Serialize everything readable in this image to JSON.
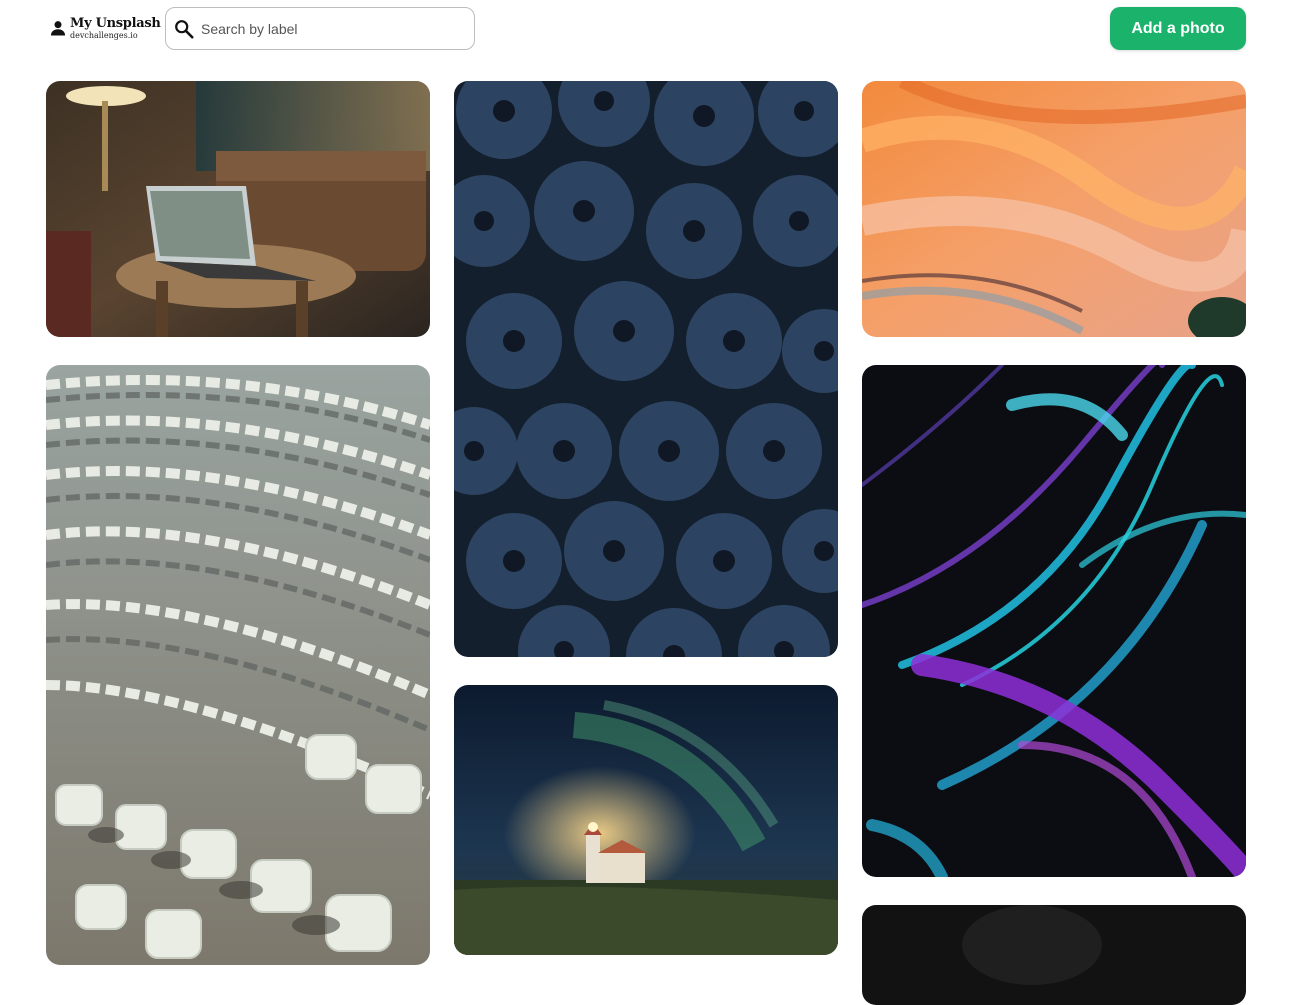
{
  "header": {
    "brand_title": "My Unsplash",
    "brand_subtitle": "devchallenges.io",
    "search_placeholder": "Search by label",
    "search_value": "",
    "add_button_label": "Add a photo",
    "accent_color": "#1bb36b",
    "icons": {
      "brand": "user-icon",
      "search": "search-icon"
    }
  },
  "gallery": {
    "photos": [
      {
        "name": "photo-laptop-lounge",
        "alt": "Laptop on a round table in a lounge"
      },
      {
        "name": "photo-blueberries",
        "alt": "Close-up of blueberries"
      },
      {
        "name": "photo-orange-marble",
        "alt": "Orange fluid marble texture"
      },
      {
        "name": "photo-stadium-seats",
        "alt": "Rows of stadium seats"
      },
      {
        "name": "photo-aurora-lighthouse",
        "alt": "Aurora over a lighthouse"
      },
      {
        "name": "photo-neon-swirl",
        "alt": "Purple and cyan fluid swirls"
      },
      {
        "name": "photo-dark-portrait",
        "alt": "Dark photo"
      }
    ]
  }
}
